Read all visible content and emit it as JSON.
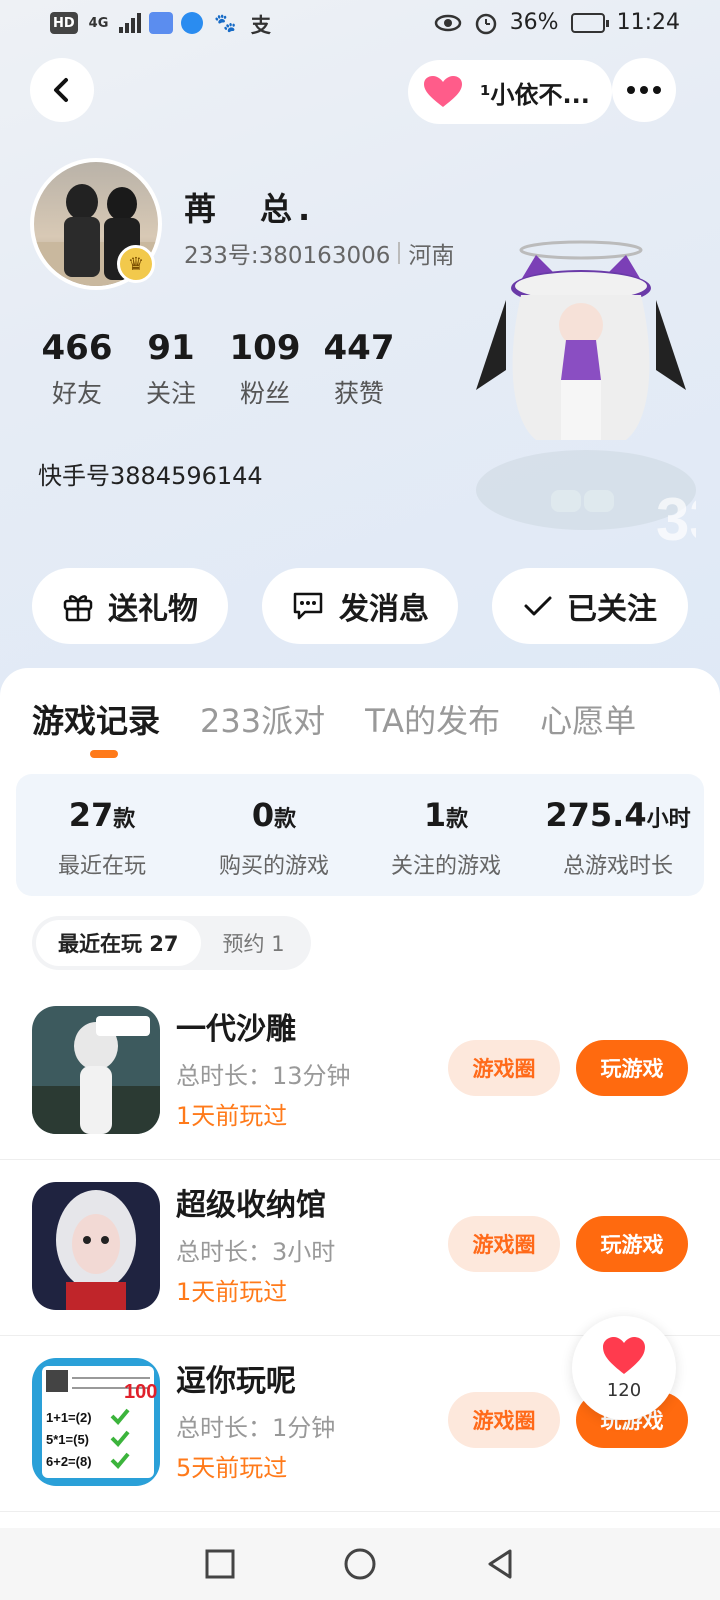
{
  "status_bar": {
    "left_icons": [
      "HD",
      "4G",
      "signal",
      "app-icon-1",
      "app-icon-2",
      "baidu-icon",
      "alipay-icon"
    ],
    "battery": "36%",
    "time": "11:24"
  },
  "header": {
    "follower_pill_text": "¹小依不..."
  },
  "profile": {
    "username": "苒　总.",
    "id_text": "233号:380163006",
    "location": "河南",
    "stats": [
      {
        "num": "466",
        "label": "好友"
      },
      {
        "num": "91",
        "label": "关注"
      },
      {
        "num": "109",
        "label": "粉丝"
      },
      {
        "num": "447",
        "label": "获赞"
      }
    ],
    "kuaishou": "快手号3884596144"
  },
  "actions": {
    "gift": "送礼物",
    "message": "发消息",
    "follow": "已关注"
  },
  "tabs": [
    "游戏记录",
    "233派对",
    "TA的发布",
    "心愿单"
  ],
  "summary": [
    {
      "val": "27",
      "unit": "款",
      "label": "最近在玩"
    },
    {
      "val": "0",
      "unit": "款",
      "label": "购买的游戏"
    },
    {
      "val": "1",
      "unit": "款",
      "label": "关注的游戏"
    },
    {
      "val": "275.4",
      "unit": "小时",
      "label": "总游戏时长"
    }
  ],
  "subtabs": [
    "最近在玩 27",
    "预约 1"
  ],
  "games": [
    {
      "name": "一代沙雕",
      "duration": "总时长：13分钟",
      "last": "1天前玩过",
      "circle": "游戏圈",
      "play": "玩游戏"
    },
    {
      "name": "超级收纳馆",
      "duration": "总时长：3小时",
      "last": "1天前玩过",
      "circle": "游戏圈",
      "play": "玩游戏"
    },
    {
      "name": "逗你玩呢",
      "duration": "总时长：1分钟",
      "last": "5天前玩过",
      "circle": "游戏圈",
      "play": "玩游戏"
    }
  ],
  "like_count": "120"
}
